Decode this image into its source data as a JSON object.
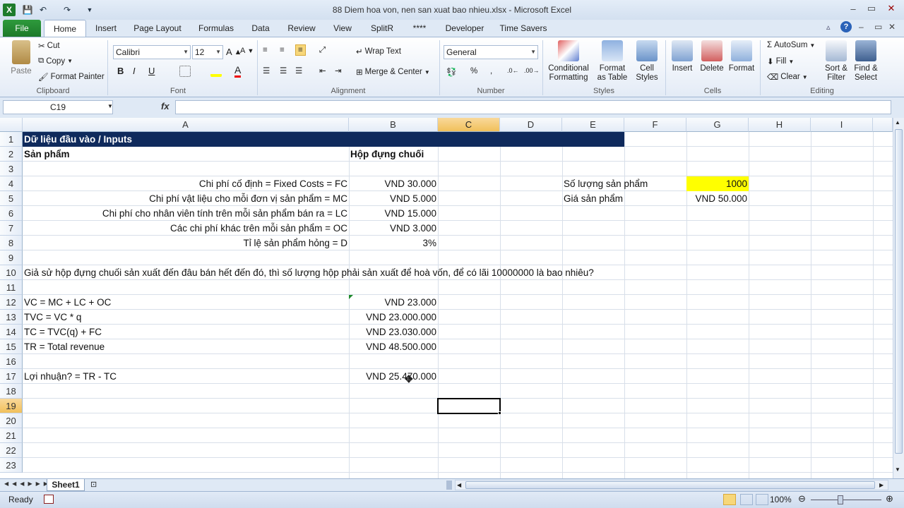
{
  "window": {
    "title": "88 Diem hoa von, nen san xuat bao nhieu.xlsx - Microsoft Excel"
  },
  "tabs": [
    "File",
    "Home",
    "Insert",
    "Page Layout",
    "Formulas",
    "Data",
    "Review",
    "View",
    "SplitR",
    "****",
    "Developer",
    "Time Savers"
  ],
  "ribbon": {
    "clipboard": {
      "paste": "Paste",
      "cut": "Cut",
      "copy": "Copy",
      "format_painter": "Format Painter",
      "label": "Clipboard"
    },
    "font": {
      "name": "Calibri",
      "size": "12",
      "label": "Font"
    },
    "alignment": {
      "wrap": "Wrap Text",
      "merge": "Merge & Center",
      "label": "Alignment"
    },
    "number": {
      "format": "General",
      "label": "Number"
    },
    "styles": {
      "conditional": [
        "Conditional",
        "Formatting"
      ],
      "as_table": [
        "Format",
        "as Table"
      ],
      "cell_styles": [
        "Cell",
        "Styles"
      ],
      "label": "Styles"
    },
    "cells": {
      "insert": "Insert",
      "delete": "Delete",
      "format": "Format",
      "label": "Cells"
    },
    "editing": {
      "autosum": "AutoSum",
      "fill": "Fill",
      "clear": "Clear",
      "sort": [
        "Sort &",
        "Filter"
      ],
      "find": [
        "Find &",
        "Select"
      ],
      "label": "Editing"
    }
  },
  "formula_bar": {
    "name_box": "C19",
    "fx": "fx",
    "formula": ""
  },
  "columns": [
    "A",
    "B",
    "C",
    "D",
    "E",
    "F",
    "G",
    "H",
    "I"
  ],
  "rows": [
    "1",
    "2",
    "3",
    "4",
    "5",
    "6",
    "7",
    "8",
    "9",
    "10",
    "11",
    "12",
    "13",
    "14",
    "15",
    "16",
    "17",
    "18",
    "19",
    "20",
    "21",
    "22",
    "23"
  ],
  "cells": {
    "A1": "Dữ liệu đầu vào / Inputs",
    "A2": "Sản phẩm",
    "B2": "Hộp đựng chuối",
    "A4": "Chi phí cố định = Fixed Costs = FC",
    "B4": "VND 30.000",
    "A5": "Chi phí vật liệu cho mỗi đơn vị sản phẩm = MC",
    "B5": "VND 5.000",
    "A6": "Chi phí cho nhân viên tính trên mỗi sản phẩm bán ra = LC",
    "B6": "VND 15.000",
    "A7": "Các chi phí khác trên mỗi sản phẩm = OC",
    "B7": "VND 3.000",
    "A8": "Tỉ lệ sản phẩm hỏng = D",
    "B8": "3%",
    "E4": "Số lượng sản phẩm",
    "G4": "1000",
    "E5": "Giá sản phẩm",
    "G5": "VND 50.000",
    "A10": "Giả sử hộp đựng chuối sản xuất đến đâu bán hết đến đó, thì số lượng hộp phải sản xuất để hoà vốn, để có lãi 10000000 là bao nhiêu?",
    "A12": "VC = MC + LC + OC",
    "B12": "VND 23.000",
    "A13": "TVC = VC * q",
    "B13": "VND 23.000.000",
    "A14": "TC = TVC(q) + FC",
    "B14": "VND 23.030.000",
    "A15": "TR = Total revenue",
    "B15": "VND 48.500.000",
    "A17": "Lợi nhuận? = TR - TC",
    "B17": "VND 25.470.000"
  },
  "sheet_tab": "Sheet1",
  "status": {
    "ready": "Ready",
    "zoom": "100%"
  },
  "colors": {
    "header_fill": "#0f2a5c",
    "highlight": "#ffff00",
    "file_tab": "#1e7b2c"
  }
}
